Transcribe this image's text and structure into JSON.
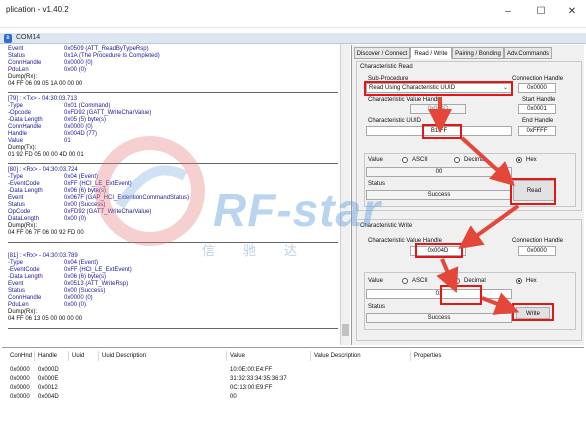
{
  "window": {
    "title": "plication - v1.40.2",
    "minimize": "–",
    "maximize": "☐",
    "close": "✕"
  },
  "mdi": {
    "title": "COM14"
  },
  "log": {
    "block1": [
      {
        "k": "Event",
        "v": "0x0509 (ATT_ReadByTypeRsp)"
      },
      {
        "k": "Status",
        "v": "0x1A (The Procedure Is Completed)"
      },
      {
        "k": "ConnHandle",
        "v": "0x0000 (0)"
      },
      {
        "k": "PduLen",
        "v": "0x00 (0)"
      }
    ],
    "dump1_label": "Dump(Rx):",
    "dump1": "04 FF 06 09 05 1A 00 00 00",
    "hdr2": "[79] : <Tx> - 04:30:03.713",
    "block2": [
      {
        "k": "-Type",
        "v": "0x01 (Command)"
      },
      {
        "k": "-Opcode",
        "v": "0xFD92 (GATT_WriteCharValue)"
      },
      {
        "k": "-Data Length",
        "v": "0x05 (5) byte(s)"
      },
      {
        "k": " ConnHandle",
        "v": "0x0000 (0)"
      },
      {
        "k": " Handle",
        "v": "0x004D (77)"
      },
      {
        "k": " Value",
        "v": "01"
      }
    ],
    "dump2_label": "Dump(Tx):",
    "dump2": "01 92 FD 05 00 00 4D 00 01",
    "hdr3": "[80] : <Rx> - 04:30:03.724",
    "block3": [
      {
        "k": "-Type",
        "v": "0x04 (Event)"
      },
      {
        "k": "-EventCode",
        "v": "0xFF (HCI_LE_ExtEvent)"
      },
      {
        "k": "-Data Length",
        "v": "0x06 (6) byte(s)"
      },
      {
        "k": " Event",
        "v": "0x067F (GAP_HCI_ExtentionCommandStatus)"
      },
      {
        "k": " Status",
        "v": "0x00 (Success)"
      },
      {
        "k": " OpCode",
        "v": "0xFD92 (GATT_WriteCharValue)"
      },
      {
        "k": " DataLength",
        "v": "0x00 (0)"
      }
    ],
    "dump3_label": "Dump(Rx):",
    "dump3": "04 FF 06 7F 06 00 92 FD 00",
    "hdr4": "[81] : <Rx> - 04:30:03.789",
    "block4": [
      {
        "k": "-Type",
        "v": "0x04 (Event)"
      },
      {
        "k": "-EventCode",
        "v": "0xFF (HCI_LE_ExtEvent)"
      },
      {
        "k": "-Data Length",
        "v": "0x06 (6) byte(s)"
      },
      {
        "k": " Event",
        "v": "0x0513 (ATT_WriteRsp)"
      },
      {
        "k": " Status",
        "v": "0x00 (Success)"
      },
      {
        "k": " ConnHandle",
        "v": "0x0000 (0)"
      },
      {
        "k": " PduLen",
        "v": "0x00 (0)"
      }
    ],
    "dump4_label": "Dump(Rx):",
    "dump4": "04 FF 06 13 05 00 00 00 00"
  },
  "tabs": [
    "Discover / Connect",
    "Read / Write",
    "Pairing / Bonding",
    "Adv.Commands"
  ],
  "read": {
    "group_label": "Characteristic Read",
    "subproc_label": "Sub-Procedure",
    "subproc_value": "Read Using Characteristic UUID",
    "connhandle_label": "Connection Handle",
    "connhandle_value": "0x0000",
    "cvh_label": "Characteristic Value Handle",
    "cvh_value": "0x004D",
    "start_label": "Start Handle",
    "start_value": "0x0001",
    "uuid_label": "Characteristic UUID",
    "uuid_value": "B1:FF",
    "end_label": "End Handle",
    "end_value": "0xFFFF",
    "value_label": "Value",
    "ascii": "ASCII",
    "decimal": "Decimal",
    "hex": "Hex",
    "value": "00",
    "status_label": "Status",
    "status_value": "Success",
    "read_button": "Read"
  },
  "write": {
    "group_label": "Characteristic Write",
    "cvh_label": "Characteristic Value Handle",
    "cvh_value": "0x004D",
    "connhandle_label": "Connection Handle",
    "connhandle_value": "0x0000",
    "value_label": "Value",
    "ascii": "ASCII",
    "decimal": "Decimal",
    "hex": "Hex",
    "value": "01",
    "status_label": "Status",
    "status_value": "Success",
    "write_button": "Write"
  },
  "table": {
    "headers": [
      "ConHnd",
      "Handle",
      "Uuid",
      "Uuid Description",
      "Value",
      "Value Description",
      "Properties"
    ],
    "rows": [
      [
        "0x0000",
        "0x000D",
        "",
        "",
        "10:0E:00:E4:FF",
        "",
        ""
      ],
      [
        "0x0000",
        "0x000E",
        "",
        "",
        "31:32:33:34:35:36:37",
        "",
        ""
      ],
      [
        "0x0000",
        "0x0012",
        "",
        "",
        "0C:13:00:E9:FF",
        "",
        ""
      ],
      [
        "0x0000",
        "0x004D",
        "",
        "",
        "00",
        "",
        ""
      ]
    ]
  },
  "watermark": {
    "brand": "RF-star",
    "sub": "信驰达"
  },
  "colors": {
    "highlight": "#e01818",
    "arrow": "#e4473a",
    "log_text": "#1a1a9a",
    "panel_bg": "#f0f0f0"
  }
}
